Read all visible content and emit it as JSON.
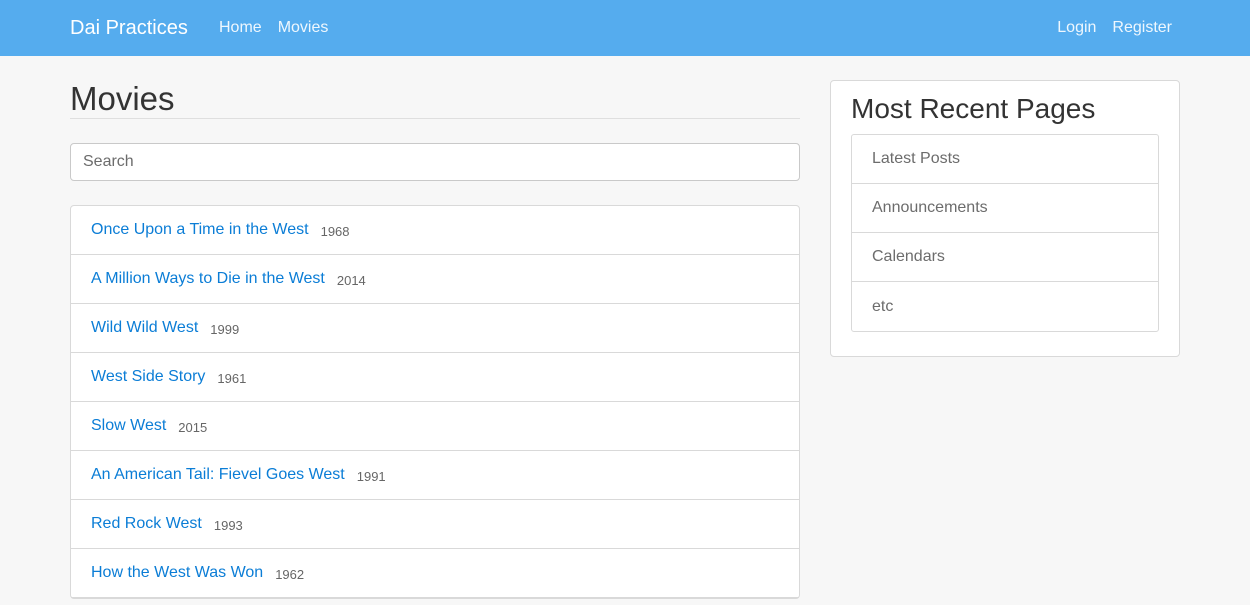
{
  "navbar": {
    "brand": "Dai Practices",
    "left_links": [
      {
        "label": "Home"
      },
      {
        "label": "Movies"
      }
    ],
    "right_links": [
      {
        "label": "Login"
      },
      {
        "label": "Register"
      }
    ],
    "colors": {
      "background": "#55acee",
      "text": "#ffffff"
    }
  },
  "main": {
    "title": "Movies",
    "search": {
      "placeholder": "Search",
      "value": ""
    },
    "movies": [
      {
        "title": "Once Upon a Time in the West",
        "year": "1968"
      },
      {
        "title": "A Million Ways to Die in the West",
        "year": "2014"
      },
      {
        "title": "Wild Wild West",
        "year": "1999"
      },
      {
        "title": "West Side Story",
        "year": "1961"
      },
      {
        "title": "Slow West",
        "year": "2015"
      },
      {
        "title": "An American Tail: Fievel Goes West",
        "year": "1991"
      },
      {
        "title": "Red Rock West",
        "year": "1993"
      },
      {
        "title": "How the West Was Won",
        "year": "1962"
      }
    ],
    "colors": {
      "link": "#0b7dd6"
    }
  },
  "sidebar": {
    "title": "Most Recent Pages",
    "items": [
      {
        "label": "Latest Posts"
      },
      {
        "label": "Announcements"
      },
      {
        "label": "Calendars"
      },
      {
        "label": "etc"
      }
    ]
  }
}
